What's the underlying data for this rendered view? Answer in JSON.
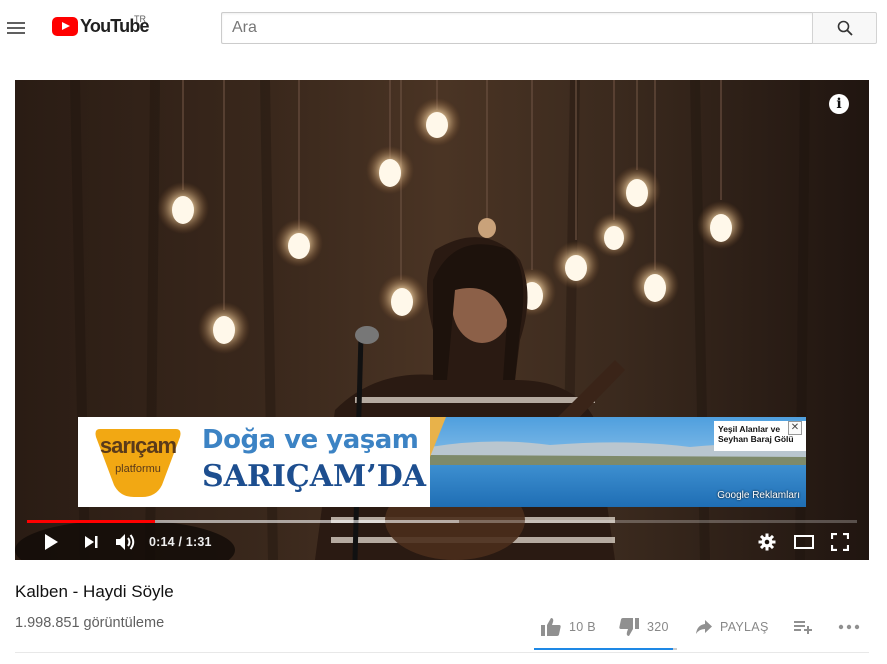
{
  "header": {
    "logo_text": "YouTube",
    "country_code": "TR",
    "search_placeholder": "Ara"
  },
  "player": {
    "current_time": "0:14",
    "duration": "1:31",
    "time_display": "0:14 / 1:31",
    "progress_fraction": 0.154,
    "buffered_fraction": 0.52,
    "ad": {
      "logo_title": "sarıçam",
      "logo_subtitle": "platformu",
      "headline_1": "Doğa ve yaşam",
      "headline_2": "SARIÇAM’DA",
      "caption_line_1": "Yeşil Alanlar ve",
      "caption_line_2": "Seyhan Baraj Gölü",
      "close_symbol": "✕",
      "provider": "Google Reklamları"
    }
  },
  "video": {
    "title": "Kalben - Haydi Söyle",
    "views": "1.998.851 görüntüleme",
    "likes": "10 B",
    "dislikes": "320",
    "share_label": "PAYLAŞ",
    "like_ratio": 0.969
  },
  "icons": {
    "menu": "hamburger-icon",
    "search": "search-icon",
    "info": "info-icon",
    "play": "play-icon",
    "next": "next-icon",
    "volume": "volume-icon",
    "settings": "gear-icon",
    "theater": "theater-mode-icon",
    "fullscreen": "fullscreen-icon",
    "like": "thumbs-up-icon",
    "dislike": "thumbs-down-icon",
    "share": "share-icon",
    "add_to_playlist": "add-to-playlist-icon",
    "more": "more-icon"
  },
  "colors": {
    "brand_red": "#ff0000",
    "progress_red": "#ff0000",
    "like_blue": "#1e88e5",
    "text_secondary": "#606060"
  }
}
